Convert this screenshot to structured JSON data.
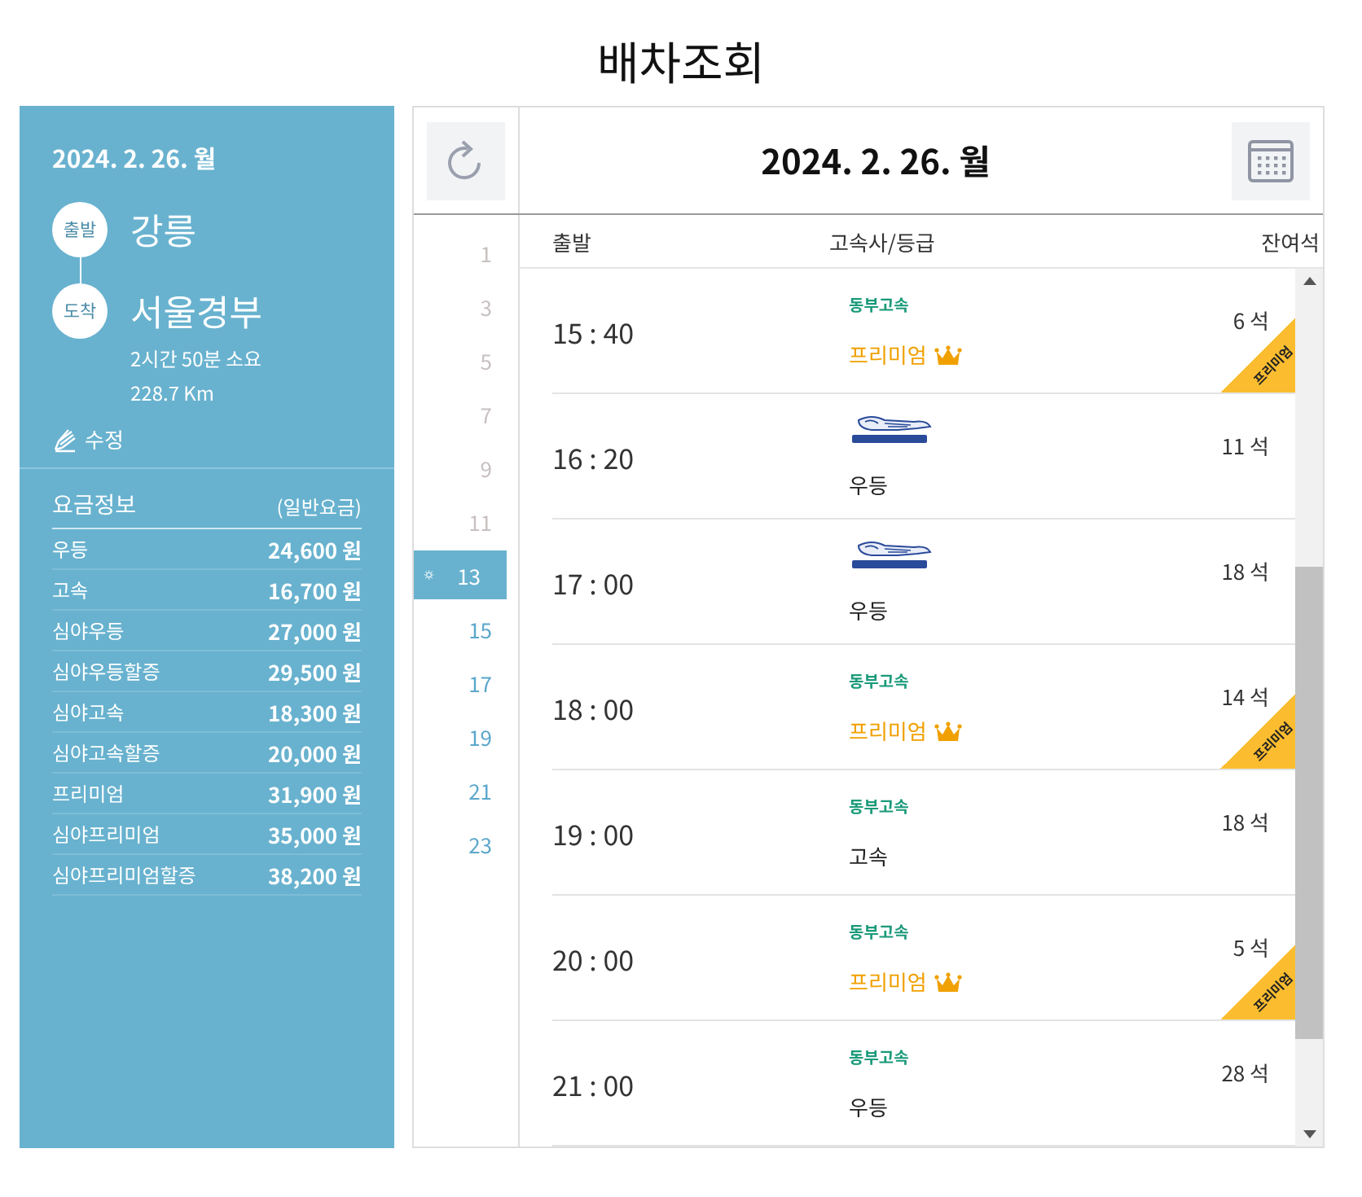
{
  "page_title": "배차조회",
  "summary": {
    "date": "2024. 2. 26. 월",
    "departure": {
      "badge": "출발",
      "place": "강릉"
    },
    "arrival": {
      "badge": "도착",
      "place": "서울경부"
    },
    "duration": "2시간 50분 소요",
    "distance": "228.7 Km",
    "edit_label": "수정"
  },
  "fares": {
    "title": "요금정보",
    "note": "(일반요금)",
    "rows": [
      {
        "grade": "우등",
        "price": "24,600 원"
      },
      {
        "grade": "고속",
        "price": "16,700 원"
      },
      {
        "grade": "심야우등",
        "price": "27,000 원"
      },
      {
        "grade": "심야우등할증",
        "price": "29,500 원"
      },
      {
        "grade": "심야고속",
        "price": "18,300 원"
      },
      {
        "grade": "심야고속할증",
        "price": "20,000 원"
      },
      {
        "grade": "프리미엄",
        "price": "31,900 원"
      },
      {
        "grade": "심야프리미엄",
        "price": "35,000 원"
      },
      {
        "grade": "심야프리미엄할증",
        "price": "38,200 원"
      }
    ]
  },
  "schedule": {
    "date": "2024. 2. 26. 월",
    "hours": [
      {
        "label": "1",
        "past": true,
        "selected": false
      },
      {
        "label": "3",
        "past": true,
        "selected": false
      },
      {
        "label": "5",
        "past": true,
        "selected": false
      },
      {
        "label": "7",
        "past": true,
        "selected": false
      },
      {
        "label": "9",
        "past": true,
        "selected": false
      },
      {
        "label": "11",
        "past": true,
        "selected": false
      },
      {
        "label": "13",
        "past": false,
        "selected": true
      },
      {
        "label": "15",
        "past": false,
        "selected": false
      },
      {
        "label": "17",
        "past": false,
        "selected": false
      },
      {
        "label": "19",
        "past": false,
        "selected": false
      },
      {
        "label": "21",
        "past": false,
        "selected": false
      },
      {
        "label": "23",
        "past": false,
        "selected": false
      }
    ],
    "columns": [
      "출발",
      "고속사/등급",
      "잔여석"
    ],
    "rows": [
      {
        "time": "15 : 40",
        "company": {
          "kind": "text",
          "name": "동부고속"
        },
        "grade": "프리미엄",
        "premium": true,
        "ribbon": "프리미엄",
        "seats": "6 석"
      },
      {
        "time": "16 : 20",
        "company": {
          "kind": "logo"
        },
        "grade": "우등",
        "premium": false,
        "seats": "11 석"
      },
      {
        "time": "17 : 00",
        "company": {
          "kind": "logo"
        },
        "grade": "우등",
        "premium": false,
        "seats": "18 석"
      },
      {
        "time": "18 : 00",
        "company": {
          "kind": "text",
          "name": "동부고속"
        },
        "grade": "프리미엄",
        "premium": true,
        "ribbon": "프리미엄",
        "seats": "14 석"
      },
      {
        "time": "19 : 00",
        "company": {
          "kind": "text",
          "name": "동부고속"
        },
        "grade": "고속",
        "premium": false,
        "seats": "18 석"
      },
      {
        "time": "20 : 00",
        "company": {
          "kind": "text",
          "name": "동부고속"
        },
        "grade": "프리미엄",
        "premium": true,
        "ribbon": "프리미엄",
        "seats": "5 석"
      },
      {
        "time": "21 : 00",
        "company": {
          "kind": "text",
          "name": "동부고속"
        },
        "grade": "우등",
        "premium": false,
        "seats": "28 석"
      }
    ]
  }
}
